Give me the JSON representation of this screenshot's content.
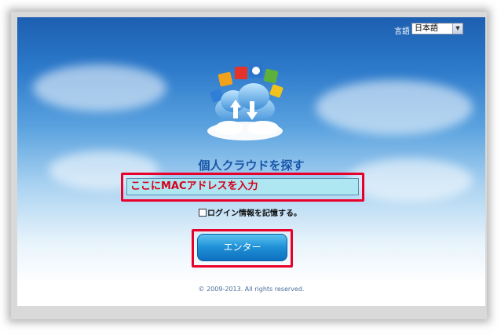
{
  "header": {
    "language_label": "言語",
    "language_selected": "日本語"
  },
  "main": {
    "title": "個人クラウドを探す",
    "mac_field_value": "ここにMACアドレスを入力",
    "remember_label": "ログイン情報を記憶する。",
    "enter_button_label": "エンター"
  },
  "footer": {
    "copyright": "© 2009-2013. All rights reserved."
  },
  "colors": {
    "highlight_border": "#e8002a",
    "title_blue": "#1a56a8",
    "button_blue": "#1e8fd6",
    "input_bg": "#aee6f2"
  }
}
